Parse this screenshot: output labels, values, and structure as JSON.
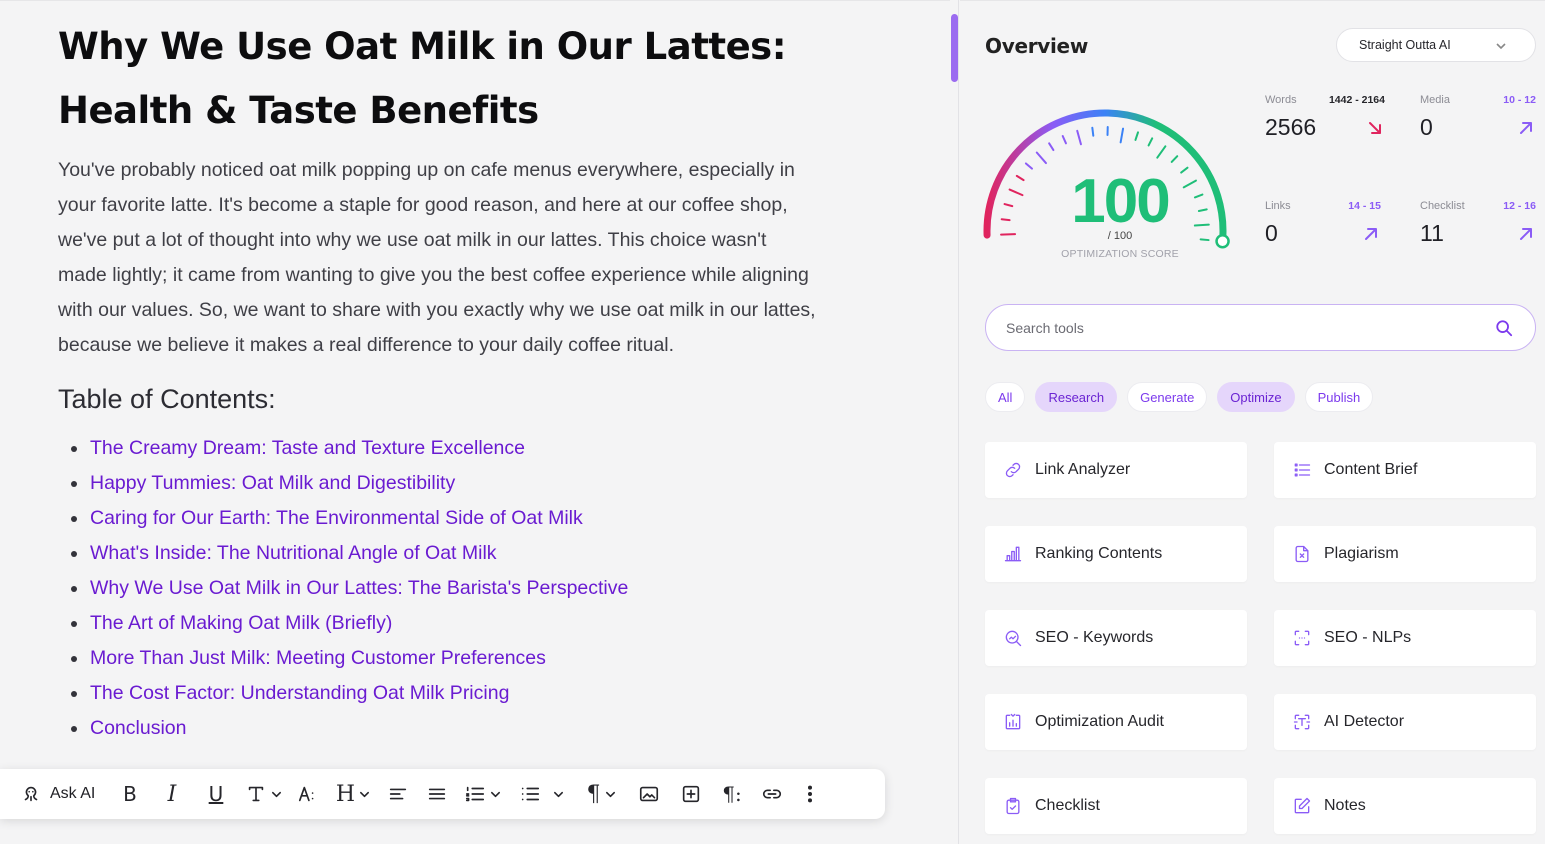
{
  "document": {
    "title": "Why We Use Oat Milk in Our Lattes: Health & Taste Benefits",
    "intro": "You've probably noticed oat milk popping up on cafe menus everywhere, especially in your favorite latte. It's become a staple for good reason, and here at our coffee shop, we've put a lot of thought into why we use oat milk in our lattes. This choice wasn't made lightly; it came from wanting to give you the best coffee experience while aligning with our values. So, we want to share with you exactly why we use oat milk in our lattes, because we believe it makes a real difference to your daily coffee ritual.",
    "toc_heading": "Table of Contents:",
    "toc": [
      "The Creamy Dream: Taste and Texture Excellence",
      "Happy Tummies: Oat Milk and Digestibility",
      "Caring for Our Earth: The Environmental Side of Oat Milk",
      "What's Inside: The Nutritional Angle of Oat Milk",
      "Why We Use Oat Milk in Our Lattes: The Barista's Perspective",
      "The Art of Making Oat Milk (Briefly)",
      "More Than Just Milk: Meeting Customer Preferences",
      "The Cost Factor: Understanding Oat Milk Pricing",
      "Conclusion"
    ]
  },
  "toolbar": {
    "ask_ai_label": "Ask AI",
    "bold": "B",
    "italic": "I",
    "underline": "U",
    "heading": "H",
    "paragraph": "¶",
    "paragraph_marks": "¶:"
  },
  "panel": {
    "title": "Overview",
    "writer_select": "Straight Outta AI",
    "score": {
      "value": "100",
      "max_label": "/ 100",
      "label": "OPTIMIZATION SCORE",
      "fraction": 1.0
    },
    "metrics": {
      "words": {
        "label": "Words",
        "range": "1442 - 2164",
        "value": "2566",
        "trend": "down",
        "color": "#e0245e"
      },
      "media": {
        "label": "Media",
        "range": "10 - 12",
        "value": "0",
        "trend": "up",
        "color": "#8b5cf6"
      },
      "links": {
        "label": "Links",
        "range": "14 - 15",
        "value": "0",
        "trend": "up",
        "color": "#8b5cf6"
      },
      "checklist": {
        "label": "Checklist",
        "range": "12 - 16",
        "value": "11",
        "trend": "up",
        "color": "#8b5cf6"
      }
    },
    "search_placeholder": "Search tools",
    "filters": [
      {
        "label": "All",
        "active": false
      },
      {
        "label": "Research",
        "active": true
      },
      {
        "label": "Generate",
        "active": false
      },
      {
        "label": "Optimize",
        "active": true
      },
      {
        "label": "Publish",
        "active": false
      }
    ],
    "tools": [
      {
        "label": "Link Analyzer",
        "icon": "link-icon"
      },
      {
        "label": "Content Brief",
        "icon": "list-icon"
      },
      {
        "label": "Ranking Contents",
        "icon": "bar-chart-icon"
      },
      {
        "label": "Plagiarism",
        "icon": "document-x-icon"
      },
      {
        "label": "SEO - Keywords",
        "icon": "magnifier-chart-icon"
      },
      {
        "label": "SEO - NLPs",
        "icon": "scan-brackets-icon"
      },
      {
        "label": "Optimization Audit",
        "icon": "audit-chart-icon"
      },
      {
        "label": "AI Detector",
        "icon": "text-scan-icon"
      },
      {
        "label": "Checklist",
        "icon": "clipboard-check-icon"
      },
      {
        "label": "Notes",
        "icon": "pencil-square-icon"
      }
    ]
  },
  "colors": {
    "accent": "#7c3aed",
    "link": "#6a1bd1",
    "score_green": "#1fbe78",
    "gauge_red": "#e0245e",
    "gauge_purple": "#8b5cf6",
    "gauge_blue": "#3b82f6"
  }
}
